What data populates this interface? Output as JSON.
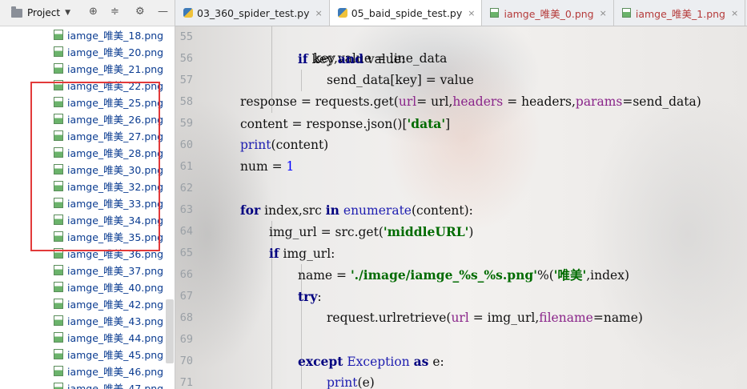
{
  "project_panel": {
    "title": "Project",
    "files": [
      "iamge_唯美_18.png",
      "iamge_唯美_20.png",
      "iamge_唯美_21.png",
      "iamge_唯美_22.png",
      "iamge_唯美_25.png",
      "iamge_唯美_26.png",
      "iamge_唯美_27.png",
      "iamge_唯美_28.png",
      "iamge_唯美_30.png",
      "iamge_唯美_32.png",
      "iamge_唯美_33.png",
      "iamge_唯美_34.png",
      "iamge_唯美_35.png",
      "iamge_唯美_36.png",
      "iamge_唯美_37.png",
      "iamge_唯美_40.png",
      "iamge_唯美_42.png",
      "iamge_唯美_43.png",
      "iamge_唯美_44.png",
      "iamge_唯美_45.png",
      "iamge_唯美_46.png",
      "iamge_唯美_47.png"
    ]
  },
  "tabs": [
    {
      "label": "03_360_spider_test.py",
      "kind": "py",
      "active": false
    },
    {
      "label": "05_baid_spide_test.py",
      "kind": "py",
      "active": true
    },
    {
      "label": "iamge_唯美_0.png",
      "kind": "png",
      "active": false
    },
    {
      "label": "iamge_唯美_1.png",
      "kind": "png",
      "active": false
    }
  ],
  "editor": {
    "line_numbers": [
      "55",
      "56",
      "57",
      "58",
      "59",
      "60",
      "61",
      "62",
      "63",
      "64",
      "65",
      "66",
      "67",
      "68",
      "69",
      "70",
      "71"
    ],
    "code": {
      "l55_a": "key,value = line_data",
      "l56_if": "if",
      "l56_a": " key ",
      "l56_and": "and",
      "l56_b": " value:",
      "l57_a": "send_data[key] = value",
      "l58_a": "response = requests.get(",
      "l58_p1": "url",
      "l58_b": "= url,",
      "l58_p2": "headers",
      "l58_c": " = headers,",
      "l58_p3": "params",
      "l58_d": "=send_data)",
      "l59_a": "content = response.json()[",
      "l59_s": "'data'",
      "l59_b": "]",
      "l60_print": "print",
      "l60_a": "(content)",
      "l61_a": "num = ",
      "l61_n": "1",
      "l63_for": "for",
      "l63_a": " index,src ",
      "l63_in": "in",
      "l63_b": " ",
      "l63_enum": "enumerate",
      "l63_c": "(content):",
      "l64_a": "img_url = src.get(",
      "l64_s": "'middleURL'",
      "l64_b": ")",
      "l65_if": "if",
      "l65_a": " img_url:",
      "l66_a": "name = ",
      "l66_s1": "'./image/iamge_%s_%s.png'",
      "l66_b": "%(",
      "l66_s2": "'唯美'",
      "l66_c": ",index)",
      "l67_try": "try",
      "l67_a": ":",
      "l68_a": "request.urlretrieve(",
      "l68_p1": "url",
      "l68_b": " = img_url,",
      "l68_p2": "filename",
      "l68_c": "=name)",
      "l70_exc": "except",
      "l70_a": " ",
      "l70_cls": "Exception",
      "l70_b": " ",
      "l70_as": "as",
      "l70_c": " e:",
      "l71_print": "print",
      "l71_a": "(e)"
    }
  },
  "colors": {
    "keyword": "#000080",
    "string": "#006b00",
    "number": "#0000ff",
    "param": "#8a258a",
    "highlight_box": "#e23a3a"
  }
}
